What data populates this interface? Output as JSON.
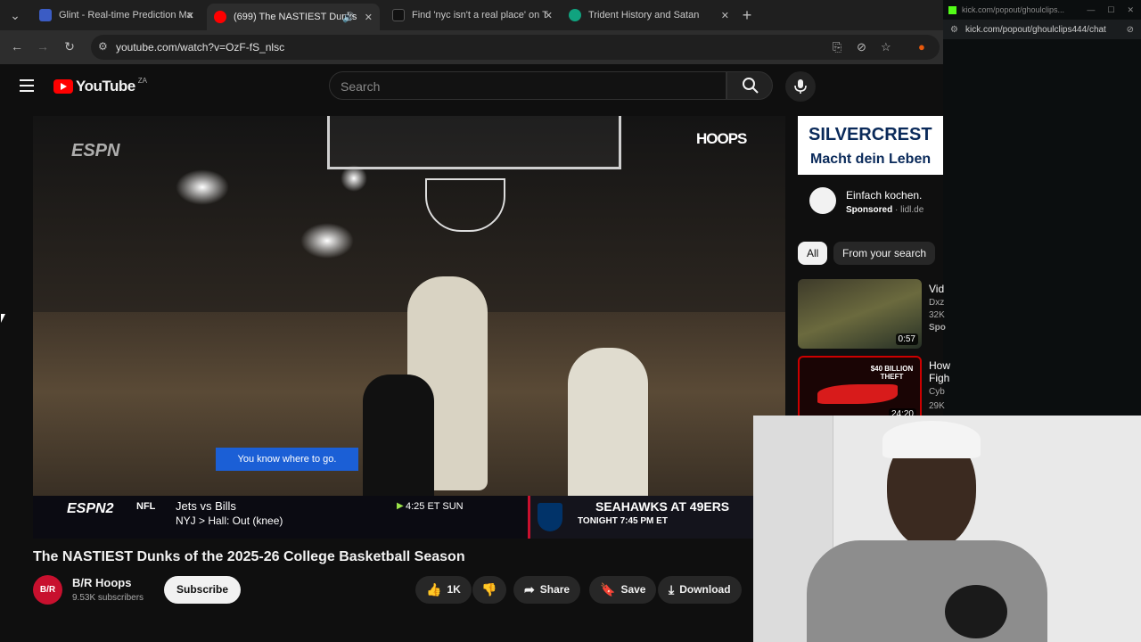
{
  "browser": {
    "tabs": [
      {
        "title": "Glint - Real-time Prediction Ma",
        "fav_color": "#3b5cc4"
      },
      {
        "title": "(699) The NASTIEST Dunks",
        "fav_color": "#ff0000"
      },
      {
        "title": "Find 'nyc isn't a real place' on T",
        "fav_color": "#111111"
      },
      {
        "title": "Trident History and Satan",
        "fav_color": "#10a37f"
      }
    ],
    "url": "youtube.com/watch?v=OzF-fS_nlsc"
  },
  "kick": {
    "title": "kick.com/popout/ghoulclips...",
    "url": "kick.com/popout/ghoulclips444/chat"
  },
  "youtube": {
    "logo": "YouTube",
    "country": "ZA",
    "search_placeholder": "Search"
  },
  "video": {
    "network": "ESPN",
    "channel_badge": "HOOPS",
    "banner": "You know where to go.",
    "scoreboard": {
      "network2": "ESPN2",
      "league": "NFL",
      "teams": "Jets vs Bills",
      "note": "NYJ  >  Hall: Out (knee)",
      "time": "4:25 ET SUN",
      "promo_matchup": "SEAHAWKS AT 49ERS",
      "promo_time": "TONIGHT 7:45 PM ET"
    }
  },
  "ad": {
    "brand": "SILVERCREST",
    "slogan": "Macht dein Leben",
    "headline": "Einfach kochen.",
    "sponsored": "Sponsored",
    "domain": "lidl.de"
  },
  "chips": [
    "All",
    "From your search"
  ],
  "recommendations": [
    {
      "title": "Vid",
      "channel": "Dxz",
      "views": "32K",
      "extra": "Spo",
      "duration": "0:57"
    },
    {
      "title": "How",
      "title2": "Figh",
      "channel": "Cyb",
      "views": "29K",
      "extra": "",
      "duration": "24:20",
      "thumb_text": "$40 BILLION THEFT"
    }
  ],
  "watch": {
    "title": "The NASTIEST Dunks of the 2025-26 College Basketball Season",
    "channel": "B/R Hoops",
    "subscribers": "9.53K subscribers",
    "subscribe": "Subscribe",
    "likes": "1K",
    "share": "Share",
    "save": "Save",
    "download": "Download"
  }
}
